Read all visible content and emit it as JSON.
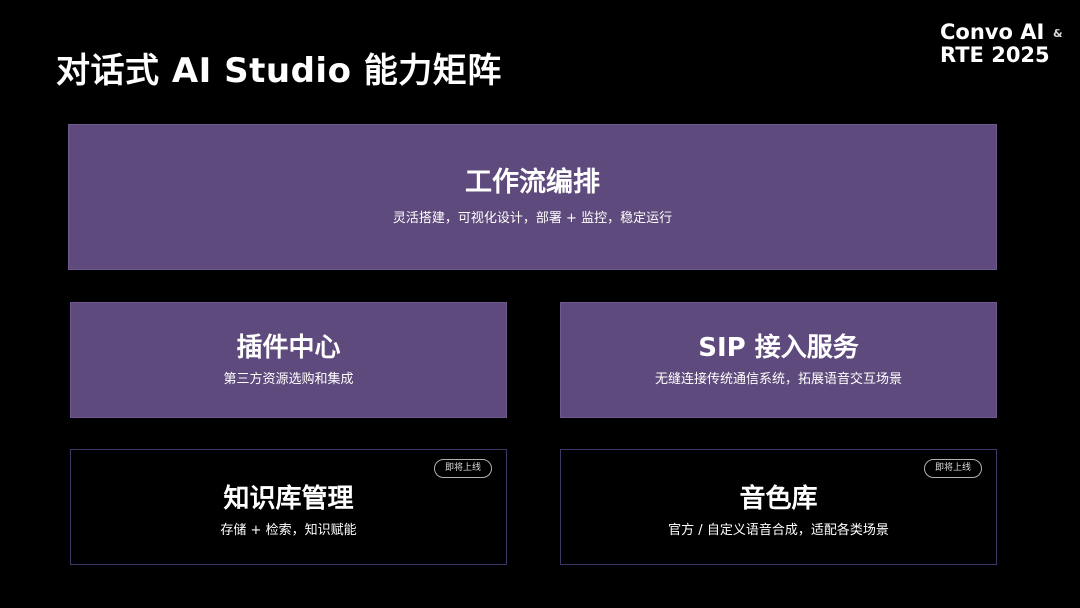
{
  "slide": {
    "title": "对话式 AI Studio 能力矩阵"
  },
  "logo": {
    "line1": "Convo AI",
    "amp": "&",
    "line2": "RTE 2025"
  },
  "cards": {
    "workflow": {
      "title": "工作流编排",
      "desc": "灵活搭建，可视化设计，部署 + 监控，稳定运行"
    },
    "plugin": {
      "title": "插件中心",
      "desc": "第三方资源选购和集成"
    },
    "sip": {
      "title": "SIP 接入服务",
      "desc": "无缝连接传统通信系统，拓展语音交互场景"
    },
    "knowledge_base": {
      "title": "知识库管理",
      "desc": "存储 + 检索，知识赋能",
      "badge": "即将上线"
    },
    "voice_library": {
      "title": "音色库",
      "desc": "官方 / 自定义语音合成，适配各类场景",
      "badge": "即将上线"
    }
  },
  "colors": {
    "background": "#000000",
    "card_fill": "#5e4a7c",
    "outline_border": "#3d3a6a",
    "text": "#ffffff"
  }
}
